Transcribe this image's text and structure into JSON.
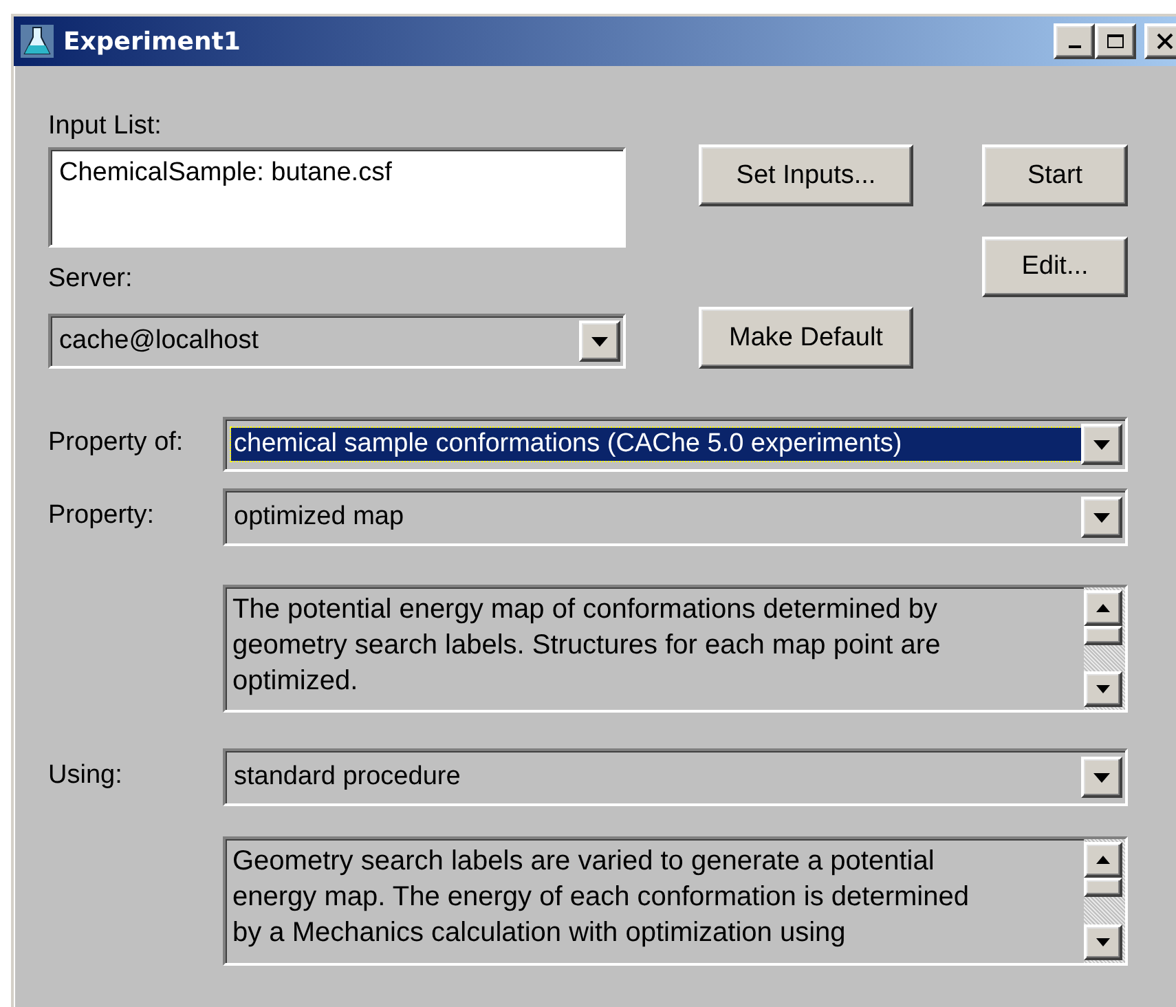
{
  "window": {
    "title": "Experiment1"
  },
  "input_list": {
    "label": "Input List:",
    "items": [
      "ChemicalSample: butane.csf"
    ]
  },
  "server": {
    "label": "Server:",
    "value": "cache@localhost"
  },
  "buttons": [
    {
      "label": "Set Inputs..."
    },
    {
      "label": "Start"
    },
    {
      "label": "Edit..."
    },
    {
      "label": "Make Default"
    }
  ],
  "property_of": {
    "label": "Property of:",
    "value": "chemical sample conformations (CAChe 5.0 experiments)",
    "highlighted": true
  },
  "property": {
    "label": "Property:",
    "value": "optimized map",
    "highlighted": false,
    "description": "The potential energy map of conformations determined by geometry search labels. Structures for each map point are optimized."
  },
  "using": {
    "label": "Using:",
    "value": "standard procedure",
    "highlighted": false,
    "description": "Geometry search labels are varied to generate a potential energy map. The energy of each conformation is determined by a Mechanics calculation with optimization using"
  }
}
